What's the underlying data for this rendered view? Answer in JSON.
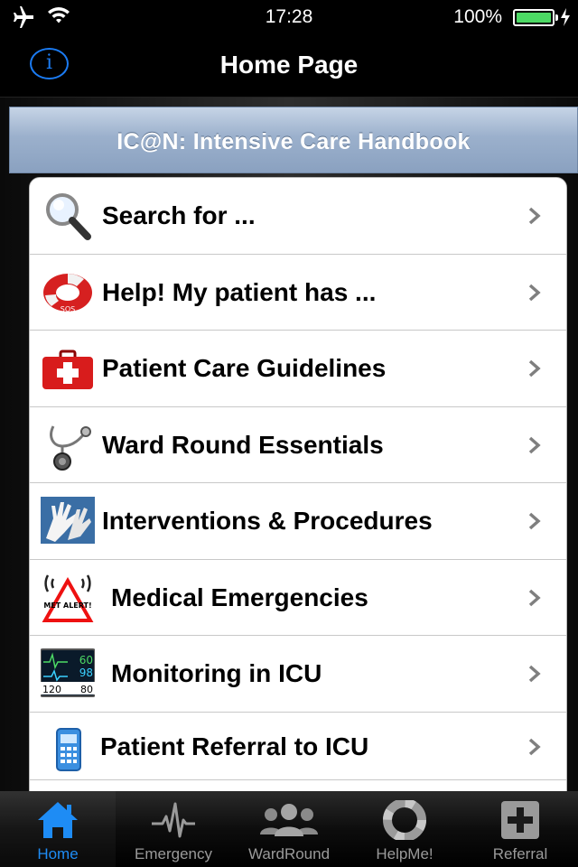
{
  "status_bar": {
    "time": "17:28",
    "battery_percent": "100%",
    "battery_level": 1.0,
    "icons": [
      "airplane-icon",
      "wifi-icon",
      "battery-icon",
      "charging-bolt-icon"
    ]
  },
  "nav_bar": {
    "title": "Home Page",
    "info_label": "i"
  },
  "banner": {
    "title": "IC@N: Intensive Care Handbook"
  },
  "menu": {
    "items": [
      {
        "label": "Search for ...",
        "icon": "magnifier-icon"
      },
      {
        "label": "Help! My patient has ...",
        "icon": "lifebuoy-sos-icon"
      },
      {
        "label": "Patient Care Guidelines",
        "icon": "first-aid-kit-icon"
      },
      {
        "label": "Ward Round Essentials",
        "icon": "stethoscope-icon"
      },
      {
        "label": "Interventions & Procedures",
        "icon": "gloves-icon"
      },
      {
        "label": "Medical Emergencies",
        "icon": "met-alert-icon",
        "icon_text": "MET ALERT!"
      },
      {
        "label": "Monitoring in ICU",
        "icon": "monitor-icon",
        "icon_text": [
          "60",
          "98",
          "120",
          "80"
        ]
      },
      {
        "label": "Patient Referral to ICU",
        "icon": "pager-icon"
      }
    ]
  },
  "tab_bar": {
    "tabs": [
      {
        "label": "Home",
        "icon": "home-icon",
        "active": true
      },
      {
        "label": "Emergency",
        "icon": "heartbeat-icon",
        "active": false
      },
      {
        "label": "WardRound",
        "icon": "group-icon",
        "active": false
      },
      {
        "label": "HelpMe!",
        "icon": "lifebuoy-icon",
        "active": false
      },
      {
        "label": "Referral",
        "icon": "plus-box-icon",
        "active": false
      }
    ]
  },
  "colors": {
    "accent_blue": "#1e8cf5",
    "battery_green": "#4cd964",
    "banner_blue": "#9bb0cc"
  }
}
